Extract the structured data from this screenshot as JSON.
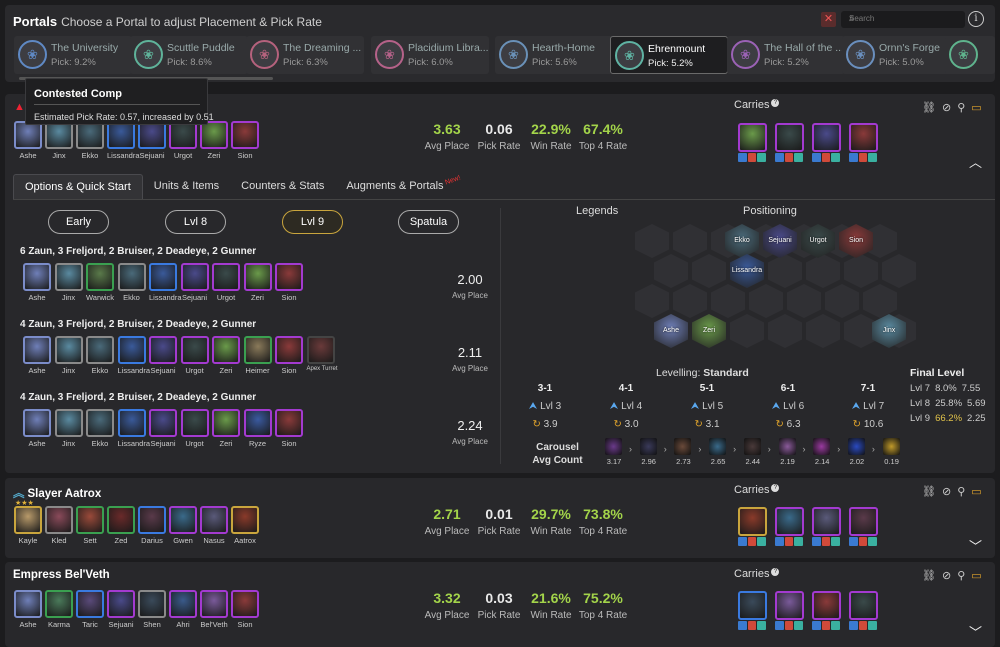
{
  "header": {
    "title": "Portals",
    "subtitle": "Choose a Portal to adjust Placement & Pick Rate",
    "search_placeholder": "Search"
  },
  "portals": [
    {
      "name": "The University",
      "pick": "Pick: 9.2%",
      "color": "#5f89c4"
    },
    {
      "name": "Scuttle Puddle",
      "pick": "Pick: 8.6%",
      "color": "#5fb39a"
    },
    {
      "name": "The Dreaming ...",
      "pick": "Pick: 6.3%",
      "color": "#b5627d"
    },
    {
      "name": "Placidium Libra...",
      "pick": "Pick: 6.0%",
      "color": "#b56289"
    },
    {
      "name": "Hearth-Home",
      "pick": "Pick: 5.6%",
      "color": "#6a91b8"
    },
    {
      "name": "Ehrenmount",
      "pick": "Pick: 5.2%",
      "color": "#5fb3a3"
    },
    {
      "name": "The Hall of the ...",
      "pick": "Pick: 5.2%",
      "color": "#9b62b5"
    },
    {
      "name": "Ornn's Forge",
      "pick": "Pick: 5.0%",
      "color": "#6a8fbe"
    },
    {
      "name": "",
      "pick": "",
      "color": "#5fb38d"
    }
  ],
  "tooltip": {
    "title": "Contested Comp",
    "desc": "Estimated Pick Rate: 0.57, increased by 0.51"
  },
  "main_comp": {
    "champions": [
      {
        "name": "Ashe",
        "color": "#6f7fb8",
        "border": "#7b8cc9"
      },
      {
        "name": "Jinx",
        "color": "#5a8aa0",
        "border": "#8a8a8a"
      },
      {
        "name": "Ekko",
        "color": "#4a6a7a",
        "border": "#8a8a8a"
      },
      {
        "name": "Lissandra",
        "color": "#3a5a9a",
        "border": "#3a7ae0"
      },
      {
        "name": "Sejuani",
        "color": "#4a4a8a",
        "border": "#3a7ae0"
      },
      {
        "name": "Urgot",
        "color": "#3a4a4a",
        "border": "#a33ad0"
      },
      {
        "name": "Zeri",
        "color": "#6a9a4a",
        "border": "#a33ad0"
      },
      {
        "name": "Sion",
        "color": "#8a3a3a",
        "border": "#a33ad0"
      }
    ],
    "stats": {
      "avg_place": "3.63",
      "avg_place_label": "Avg Place",
      "pick_rate": "0.06",
      "pick_rate_label": "Pick Rate",
      "win_rate": "22.9%",
      "win_rate_label": "Win Rate",
      "top4": "67.4%",
      "top4_label": "Top 4 Rate"
    },
    "carries_label": "Carries",
    "carries": [
      {
        "color": "#6a9a4a",
        "border": "#a33ad0"
      },
      {
        "color": "#3a4a4a",
        "border": "#a33ad0"
      },
      {
        "color": "#4a4a8a",
        "border": "#a33ad0"
      },
      {
        "color": "#8a3a3a",
        "border": "#a33ad0"
      }
    ],
    "tabs": [
      "Options & Quick Start",
      "Units & Items",
      "Counters & Stats",
      "Augments & Portals"
    ],
    "new_badge": "New!",
    "levels": [
      "Early",
      "Lvl 8",
      "Lvl 9",
      "Spatula"
    ],
    "comps": [
      {
        "title": "6 Zaun, 3 Freljord, 2 Bruiser, 2 Deadeye, 2 Gunner",
        "avg": "2.00",
        "avg_label": "Avg Place",
        "champions": [
          "Ashe",
          "Jinx",
          "Warwick",
          "Ekko",
          "Lissandra",
          "Sejuani",
          "Urgot",
          "Zeri",
          "Sion"
        ]
      },
      {
        "title": "4 Zaun, 3 Freljord, 2 Bruiser, 2 Deadeye, 2 Gunner",
        "avg": "2.11",
        "avg_label": "Avg Place",
        "champions": [
          "Ashe",
          "Jinx",
          "Ekko",
          "Lissandra",
          "Sejuani",
          "Urgot",
          "Zeri",
          "Heimer",
          "Sion",
          "Apex Turret"
        ]
      },
      {
        "title": "4 Zaun, 3 Freljord, 2 Bruiser, 2 Deadeye, 2 Gunner",
        "avg": "2.24",
        "avg_label": "Avg Place",
        "champions": [
          "Ashe",
          "Jinx",
          "Ekko",
          "Lissandra",
          "Sejuani",
          "Urgot",
          "Zeri",
          "Ryze",
          "Sion"
        ]
      }
    ],
    "legends_label": "Legends",
    "positioning_label": "Positioning",
    "board_units": [
      "Ekko",
      "Sejuani",
      "Urgot",
      "Sion",
      "Lissandra",
      "Ashe",
      "Zeri",
      "Jinx"
    ],
    "levelling_prefix": "Levelling:",
    "levelling_value": "Standard",
    "levelling": [
      {
        "stage": "3-1",
        "lvl": "Lvl 3",
        "roll": "3.9"
      },
      {
        "stage": "4-1",
        "lvl": "Lvl 4",
        "roll": "3.0"
      },
      {
        "stage": "5-1",
        "lvl": "Lvl 5",
        "roll": "3.1"
      },
      {
        "stage": "6-1",
        "lvl": "Lvl 6",
        "roll": "6.3"
      },
      {
        "stage": "7-1",
        "lvl": "Lvl 7",
        "roll": "10.6"
      }
    ],
    "final_level": {
      "title": "Final Level",
      "rows": [
        {
          "lvl": "Lvl 7",
          "pct": "8.0%",
          "avg": "7.55"
        },
        {
          "lvl": "Lvl 8",
          "pct": "25.8%",
          "avg": "5.69"
        },
        {
          "lvl": "Lvl 9",
          "pct": "66.2%",
          "avg": "2.25"
        }
      ]
    },
    "carousel_label": "Carousel",
    "carousel_sub": "Avg Count",
    "carousel": [
      {
        "v": "3.17",
        "c": "#6a3a8a"
      },
      {
        "v": "2.96",
        "c": "#3a3a5a"
      },
      {
        "v": "2.73",
        "c": "#6a4a3a"
      },
      {
        "v": "2.65",
        "c": "#3a6a8a"
      },
      {
        "v": "2.44",
        "c": "#4a3a3a"
      },
      {
        "v": "2.19",
        "c": "#8a5a9a"
      },
      {
        "v": "2.14",
        "c": "#9a3aa0"
      },
      {
        "v": "2.02",
        "c": "#2a4ac0"
      },
      {
        "v": "0.19",
        "c": "#c09a2a"
      }
    ]
  },
  "aatrox": {
    "title": "Slayer Aatrox",
    "champions": [
      {
        "name": "Kayle",
        "color": "#b89a6a",
        "border": "#c9a53d"
      },
      {
        "name": "Kled",
        "color": "#8a4a5a",
        "border": "#8a8a8a"
      },
      {
        "name": "Sett",
        "color": "#9a4a3a",
        "border": "#3aa050"
      },
      {
        "name": "Zed",
        "color": "#6a2a2a",
        "border": "#3aa050"
      },
      {
        "name": "Darius",
        "color": "#5a3a4a",
        "border": "#3a7ae0"
      },
      {
        "name": "Gwen",
        "color": "#3a6a8a",
        "border": "#a33ad0"
      },
      {
        "name": "Nasus",
        "color": "#5a5a7a",
        "border": "#a33ad0"
      },
      {
        "name": "Aatrox",
        "color": "#8a3a2a",
        "border": "#c9a53d"
      }
    ],
    "stats": {
      "avg_place": "2.71",
      "avg_place_label": "Avg Place",
      "pick_rate": "0.01",
      "pick_rate_label": "Pick Rate",
      "win_rate": "29.7%",
      "win_rate_label": "Win Rate",
      "top4": "73.8%",
      "top4_label": "Top 4 Rate"
    },
    "carries_label": "Carries",
    "carries": [
      {
        "color": "#8a3a2a",
        "border": "#c9a53d"
      },
      {
        "color": "#3a6a8a",
        "border": "#a33ad0"
      },
      {
        "color": "#5a5a7a",
        "border": "#a33ad0"
      },
      {
        "color": "#5a3a4a",
        "border": "#a33ad0"
      }
    ]
  },
  "belveth": {
    "title": "Empress Bel'Veth",
    "champions": [
      {
        "name": "Ashe",
        "color": "#6f7fb8",
        "border": "#7b8cc9"
      },
      {
        "name": "Karma",
        "color": "#4a7a5a",
        "border": "#3aa050"
      },
      {
        "name": "Taric",
        "color": "#5a4a7a",
        "border": "#3a7ae0"
      },
      {
        "name": "Sejuani",
        "color": "#4a4a8a",
        "border": "#a33ad0"
      },
      {
        "name": "Shen",
        "color": "#3a4a5a",
        "border": "#8a8a8a"
      },
      {
        "name": "Ahri",
        "color": "#3a5a8a",
        "border": "#a33ad0"
      },
      {
        "name": "Bel'Veth",
        "color": "#7a5a9a",
        "border": "#a33ad0"
      },
      {
        "name": "Sion",
        "color": "#8a3a3a",
        "border": "#a33ad0"
      }
    ],
    "stats": {
      "avg_place": "3.32",
      "avg_place_label": "Avg Place",
      "pick_rate": "0.03",
      "pick_rate_label": "Pick Rate",
      "win_rate": "21.6%",
      "win_rate_label": "Win Rate",
      "top4": "75.2%",
      "top4_label": "Top 4 Rate"
    },
    "carries_label": "Carries",
    "carries": [
      {
        "color": "#3a4a5a",
        "border": "#3a7ae0"
      },
      {
        "color": "#7a5a9a",
        "border": "#a33ad0"
      },
      {
        "color": "#8a3a3a",
        "border": "#a33ad0"
      },
      {
        "color": "#3a4a4a",
        "border": "#a33ad0"
      }
    ]
  }
}
